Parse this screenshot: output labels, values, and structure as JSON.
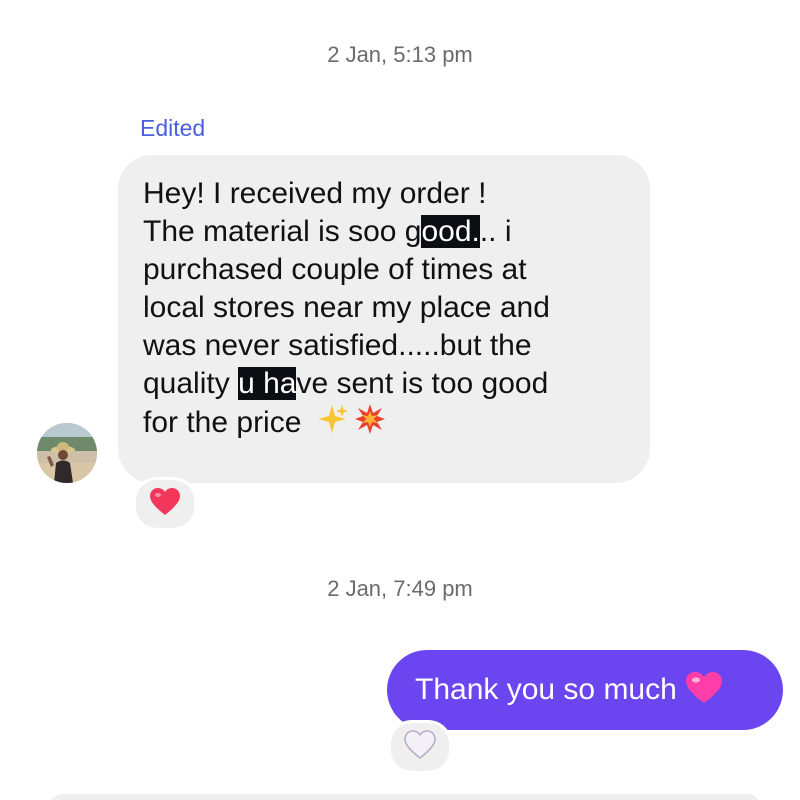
{
  "thread": {
    "timestamp_1": "2 Jan, 5:13 pm",
    "timestamp_2": "2 Jan, 7:49 pm",
    "incoming": {
      "edited_label": "Edited",
      "line_1": "Hey! I received my order !",
      "line_2_a": "The material is soo g",
      "line_2_hl": "ood.",
      "line_2_b": ".. i",
      "line_3": "purchased couple of times at",
      "line_4": "local stores near my place and",
      "line_5": "was never satisfied.....but the",
      "line_6_a": "quality ",
      "line_6_hl": "u ha",
      "line_6_b": "ve sent is too good",
      "line_7": "for the price",
      "line_7_emoji": "✨💥",
      "reaction": "❤️"
    },
    "outgoing": {
      "text": "Thank you so much",
      "emoji": "💓",
      "reaction": "🤍"
    }
  },
  "colors": {
    "accent_blue": "#4a5fe0",
    "outgoing_bubble": "#6a45f0",
    "incoming_bubble": "#efefef",
    "heart_red": "#f2375a",
    "heart_pink": "#ff3da8"
  },
  "icons": {
    "avatar": "profile-photo-woman-hat",
    "reaction_in": "red-heart-icon",
    "reaction_out": "white-heart-icon"
  }
}
